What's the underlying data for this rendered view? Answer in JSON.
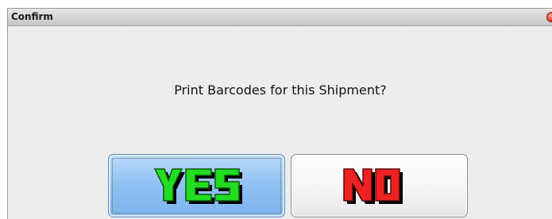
{
  "dialog": {
    "title": "Confirm",
    "message": "Print Barcodes for this Shipment?",
    "yes_label": "YES",
    "no_label": "NO",
    "yes_color": "#22dd22",
    "no_color": "#ee2222",
    "close_icon": "close-icon"
  }
}
